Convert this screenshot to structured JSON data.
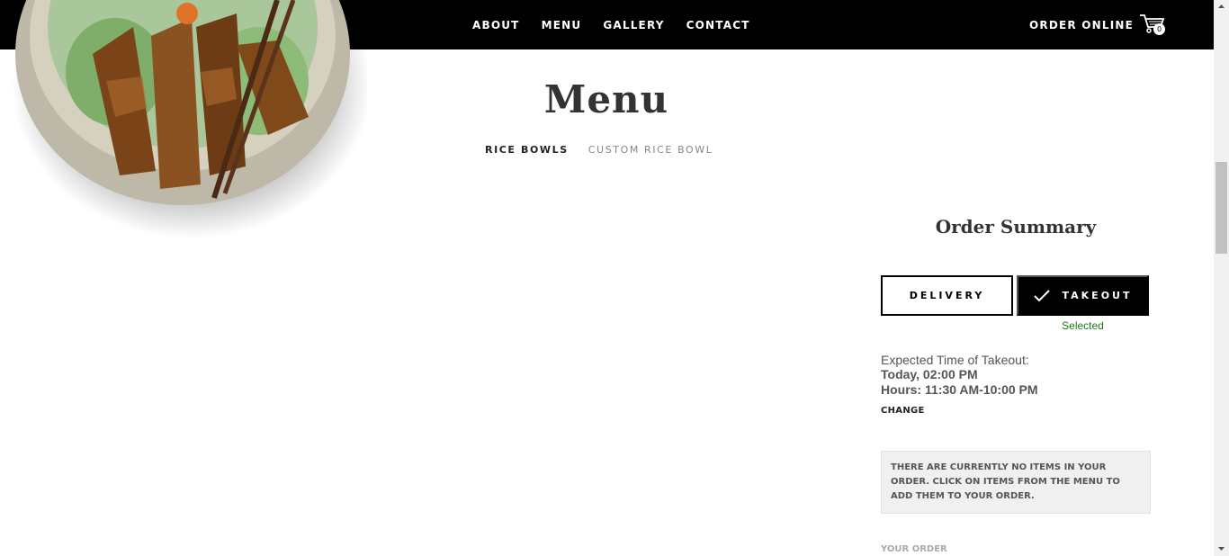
{
  "header": {
    "nav": [
      "ABOUT",
      "MENU",
      "GALLERY",
      "CONTACT"
    ],
    "order_online": "ORDER ONLINE",
    "cart_count": "0"
  },
  "menu": {
    "title": "Menu",
    "tabs": [
      "RICE BOWLS",
      "CUSTOM RICE BOWL"
    ],
    "active_tab": "RICE BOWLS"
  },
  "summary": {
    "title": "Order Summary",
    "delivery_label": "DELIVERY",
    "takeout_label": "TAKEOUT",
    "selected_text": "Selected",
    "selected_mode": "TAKEOUT",
    "expected_label": "Expected Time of Takeout:",
    "expected_time": "Today, 02:00 PM",
    "hours": "Hours: 11:30 AM-10:00 PM",
    "change_label": "CHANGE",
    "empty_message": "THERE ARE CURRENTLY NO ITEMS IN YOUR ORDER. CLICK ON ITEMS FROM THE MENU TO ADD THEM TO YOUR ORDER.",
    "your_order_label": "YOUR ORDER"
  },
  "icons": {
    "logo": "striped-circle-logo",
    "cart": "shopping-cart-icon",
    "check": "checkmark-icon"
  },
  "colors": {
    "header_bg": "#000000",
    "selected_green": "#1a7a1a",
    "empty_box_bg": "#f0f0f0"
  }
}
